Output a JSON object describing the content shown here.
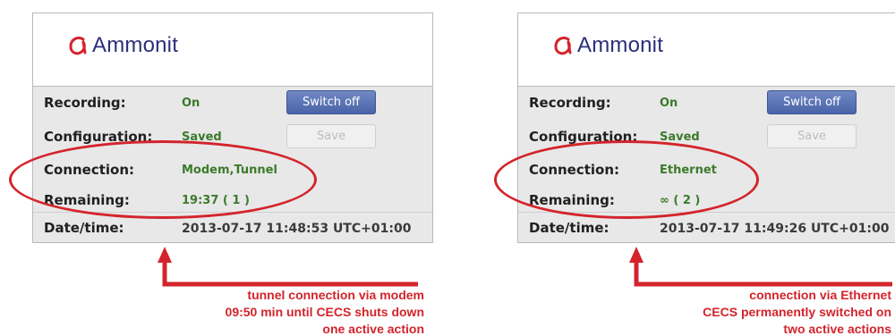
{
  "panels": [
    {
      "logo_text": "Ammonit",
      "rows": {
        "recording_label": "Recording:",
        "recording_value": "On",
        "configuration_label": "Configuration:",
        "configuration_value": "Saved",
        "connection_label": "Connection:",
        "connection_value": "Modem,Tunnel",
        "remaining_label": "Remaining:",
        "remaining_value": "19:37 ( 1 )",
        "datetime_label": "Date/time:",
        "datetime_value": "2013-07-17 11:48:53 UTC+01:00"
      },
      "buttons": {
        "switch_off": "Switch off",
        "save": "Save"
      },
      "annotation": [
        "tunnel connection via modem",
        "09:50 min until CECS shuts down",
        "one active action"
      ]
    },
    {
      "logo_text": "Ammonit",
      "rows": {
        "recording_label": "Recording:",
        "recording_value": "On",
        "configuration_label": "Configuration:",
        "configuration_value": "Saved",
        "connection_label": "Connection:",
        "connection_value": "Ethernet",
        "remaining_label": "Remaining:",
        "remaining_value": "∞ ( 2 )",
        "datetime_label": "Date/time:",
        "datetime_value": "2013-07-17 11:49:26 UTC+01:00"
      },
      "buttons": {
        "switch_off": "Switch off",
        "save": "Save"
      },
      "annotation": [
        "connection via Ethernet",
        "CECS permanently switched on",
        "two active actions"
      ]
    }
  ],
  "colors": {
    "brand": "#2a2f7a",
    "value_green": "#3c7a2a",
    "annotation_red": "#d3242b",
    "button_blue": "#4a64a8"
  },
  "icons": {
    "logo": "ammonit-logo-icon",
    "arrow": "arrow-up-icon"
  }
}
